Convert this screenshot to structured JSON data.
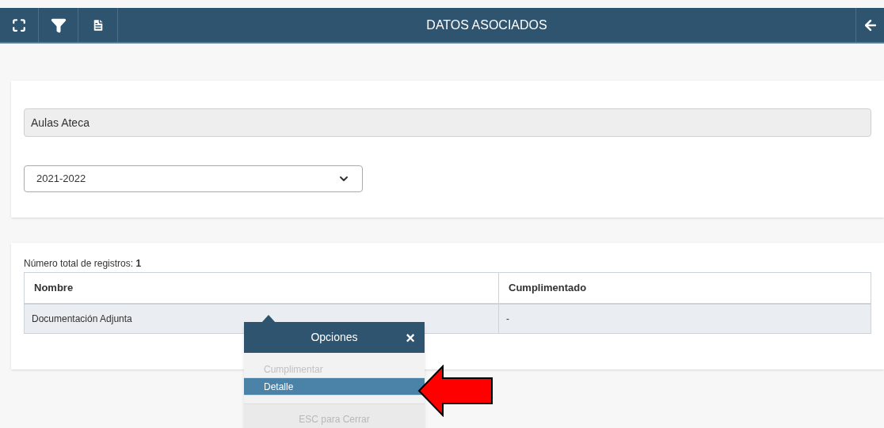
{
  "header": {
    "title": "DATOS ASOCIADOS"
  },
  "form": {
    "center_field": {
      "value": "Aulas Ateca"
    },
    "year_select": {
      "value": "2021-2022"
    }
  },
  "table": {
    "total_label": "Número total de registros:",
    "total_count": "1",
    "columns": [
      "Nombre",
      "Cumplimentado"
    ],
    "rows": [
      {
        "cells": [
          "Documentación Adjunta",
          "-"
        ],
        "selected": true
      }
    ]
  },
  "menu": {
    "title": "Opciones",
    "close": "×",
    "items": [
      {
        "label": "Cumplimentar",
        "disabled": true,
        "selected": false
      },
      {
        "label": "Detalle",
        "disabled": false,
        "selected": true
      }
    ],
    "footer": "ESC para Cerrar"
  }
}
